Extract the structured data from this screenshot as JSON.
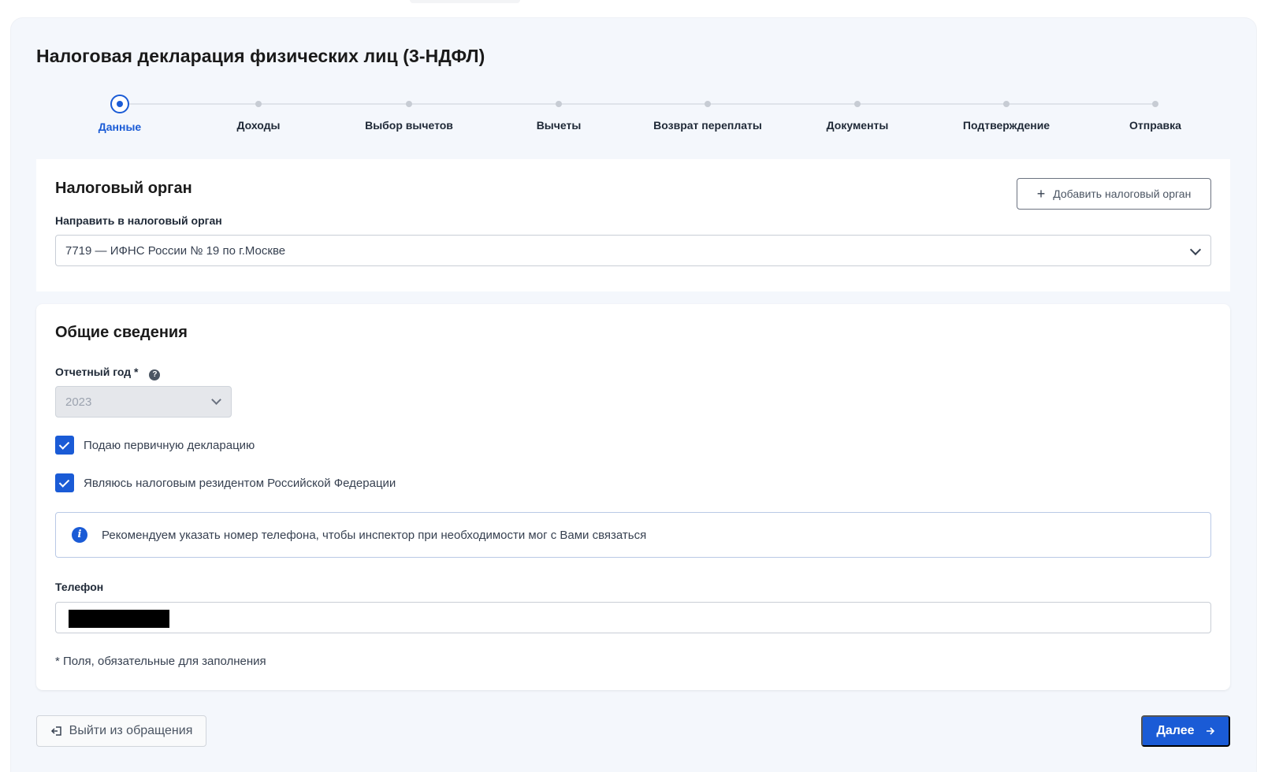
{
  "page": {
    "title": "Налоговая декларация физических лиц (3-НДФЛ)"
  },
  "stepper": {
    "steps": [
      {
        "label": "Данные",
        "active": true
      },
      {
        "label": "Доходы",
        "active": false
      },
      {
        "label": "Выбор вычетов",
        "active": false
      },
      {
        "label": "Вычеты",
        "active": false
      },
      {
        "label": "Возврат переплаты",
        "active": false
      },
      {
        "label": "Документы",
        "active": false
      },
      {
        "label": "Подтверждение",
        "active": false
      },
      {
        "label": "Отправка",
        "active": false
      }
    ]
  },
  "tax_authority": {
    "title": "Налоговый орган",
    "add_button_label": "Добавить налоговый орган",
    "send_label": "Направить в налоговый орган",
    "selected_value": "7719 — ИФНС России № 19 по г.Москве"
  },
  "general": {
    "title": "Общие сведения",
    "year_label": "Отчетный год *",
    "year_value": "2023",
    "primary_checkbox_label": "Подаю первичную декларацию",
    "primary_checked": true,
    "resident_checkbox_label": "Являюсь налоговым резидентом Российской Федерации",
    "resident_checked": true,
    "info_text": "Рекомендуем указать номер телефона, чтобы инспектор при необходимости мог с Вами связаться",
    "phone_label": "Телефон",
    "required_note": "* Поля, обязательные для заполнения"
  },
  "footer": {
    "exit_label": "Выйти из обращения",
    "next_label": "Далее"
  },
  "colors": {
    "accent": "#1a5bd6",
    "background": "#f4f7fc"
  }
}
